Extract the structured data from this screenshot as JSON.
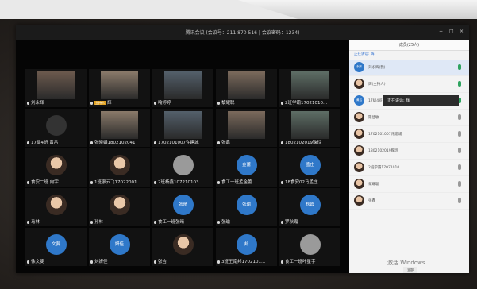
{
  "window": {
    "title": "腾讯会议 (会议号：211 870 516 | 会议密码：1234)"
  },
  "controls": {
    "min": "−",
    "max": "□",
    "close": "×"
  },
  "tiles": [
    {
      "label": "刘永辉",
      "kind": "cam"
    },
    {
      "label": "辉",
      "kind": "cam",
      "host": "主持人"
    },
    {
      "label": "喻婷婷",
      "kind": "cam"
    },
    {
      "label": "黎耀聪",
      "kind": "cam"
    },
    {
      "label": "2班学霸17021010...",
      "kind": "cam"
    },
    {
      "label": "17级4班 黄吕",
      "kind": "dark"
    },
    {
      "label": "张晓娟1802102041",
      "kind": "cam"
    },
    {
      "label": "1702101007许建城",
      "kind": "cam"
    },
    {
      "label": "张鑫",
      "kind": "cam"
    },
    {
      "label": "1802102019鞠玲",
      "kind": "cam"
    },
    {
      "label": "食安二班 向宇",
      "kind": "photo"
    },
    {
      "label": "1班廖云飞17022001...",
      "kind": "photo"
    },
    {
      "label": "2班杨鑫107210103...",
      "kind": "gray"
    },
    {
      "label": "食工一班孟金蕾",
      "kind": "blue",
      "avatar": "金蕾"
    },
    {
      "label": "18食安02马孟庄",
      "kind": "blue",
      "avatar": "孟庄"
    },
    {
      "label": "马林",
      "kind": "photo"
    },
    {
      "label": "孙林",
      "kind": "photo"
    },
    {
      "label": "食工一班张晴",
      "kind": "blue",
      "avatar": "张晴"
    },
    {
      "label": "张瑜",
      "kind": "blue",
      "avatar": "张瑜"
    },
    {
      "label": "罗秋霞",
      "kind": "blue",
      "avatar": "秋霞"
    },
    {
      "label": "徐文斐",
      "kind": "blue",
      "avatar": "文斐"
    },
    {
      "label": "刘妍佳",
      "kind": "blue",
      "avatar": "妍佳"
    },
    {
      "label": "张吉",
      "kind": "photo"
    },
    {
      "label": "3班王南邦1702101...",
      "kind": "blue",
      "avatar": "邦"
    },
    {
      "label": "食工一班叶星宇",
      "kind": "gray"
    }
  ],
  "sidebar": {
    "title": "成员(25人)",
    "subtitle": "正在讲话: 辉",
    "members": [
      {
        "name": "刘永辉(我)",
        "avatar": "永辉",
        "mic": "on"
      },
      {
        "name": "辉(主持人)",
        "avatar": "",
        "mic": "on"
      },
      {
        "name": "17级4班 黄吕",
        "avatar": "黄吕",
        "mic": "on"
      },
      {
        "name": "陈佳敏",
        "avatar": "",
        "mic": "off"
      },
      {
        "name": "1702101007许建城",
        "avatar": "",
        "mic": "off"
      },
      {
        "name": "1802102019鞠玲",
        "avatar": "",
        "mic": "off"
      },
      {
        "name": "2班学霸17021010",
        "avatar": "",
        "mic": "off"
      },
      {
        "name": "黎耀聪",
        "avatar": "",
        "mic": "off"
      },
      {
        "name": "张鑫",
        "avatar": "",
        "mic": "off"
      }
    ]
  },
  "popup": {
    "text": "正在讲话: 辉"
  },
  "taskbar": {
    "watermark": "激活 Windows",
    "button": "全部"
  }
}
